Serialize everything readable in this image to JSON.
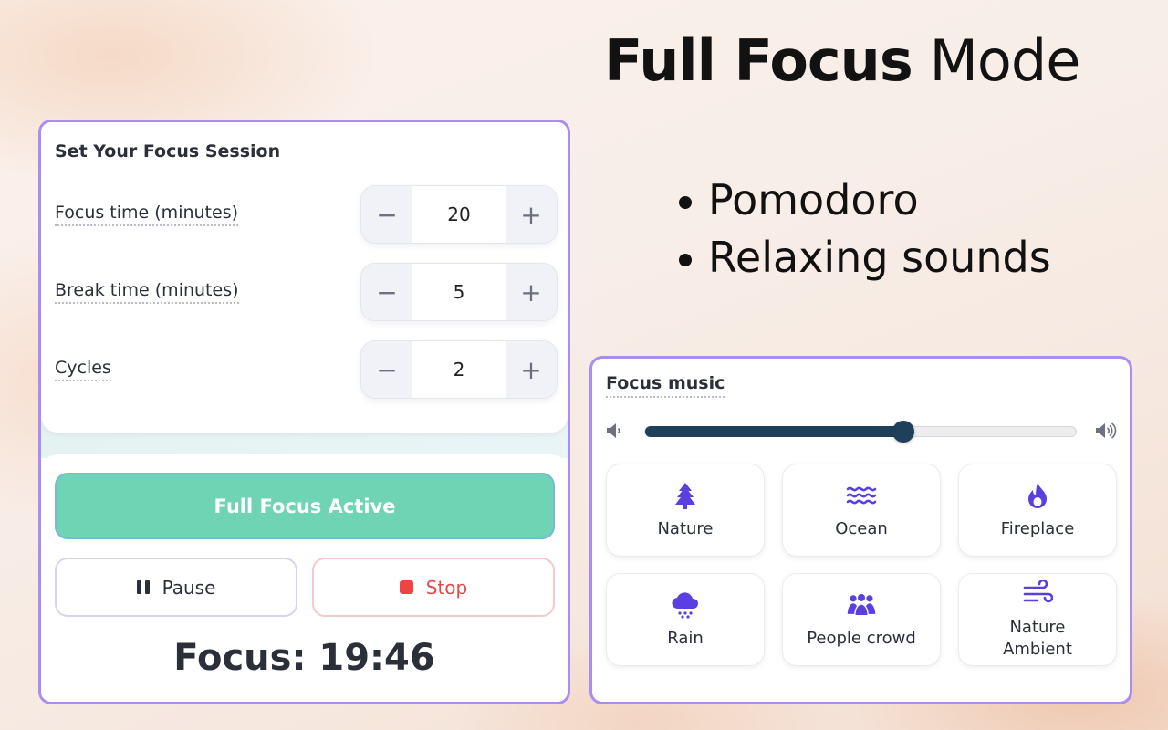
{
  "hero": {
    "title_bold": "Full Focus",
    "title_light": " Mode",
    "bullets": [
      "Pomodoro",
      "Relaxing sounds"
    ]
  },
  "session": {
    "title": "Set Your Focus Session",
    "steppers": [
      {
        "label": "Focus time (minutes)",
        "value": "20",
        "minus": "−",
        "plus": "+"
      },
      {
        "label": "Break time (minutes)",
        "value": "5",
        "minus": "−",
        "plus": "+"
      },
      {
        "label": "Cycles",
        "value": "2",
        "minus": "−",
        "plus": "+"
      }
    ],
    "active_button": "Full Focus Active",
    "pause_button": "Pause",
    "stop_button": "Stop",
    "timer": "Focus: 19:46"
  },
  "music": {
    "title": "Focus music",
    "volume_level": 0.6,
    "sounds": [
      {
        "label": "Nature",
        "icon": "tree-icon"
      },
      {
        "label": "Ocean",
        "icon": "waves-icon"
      },
      {
        "label": "Fireplace",
        "icon": "fire-icon"
      },
      {
        "label": "Rain",
        "icon": "rain-cloud-icon"
      },
      {
        "label": "People crowd",
        "icon": "people-icon"
      },
      {
        "label": "Nature\nAmbient",
        "icon": "wind-icon"
      }
    ]
  },
  "colors": {
    "accent_purple": "#a98df0",
    "icon_purple": "#5b3fe0",
    "active_green": "#6fd4b4",
    "stop_red": "#e84848",
    "slider_navy": "#1f3f5a"
  }
}
